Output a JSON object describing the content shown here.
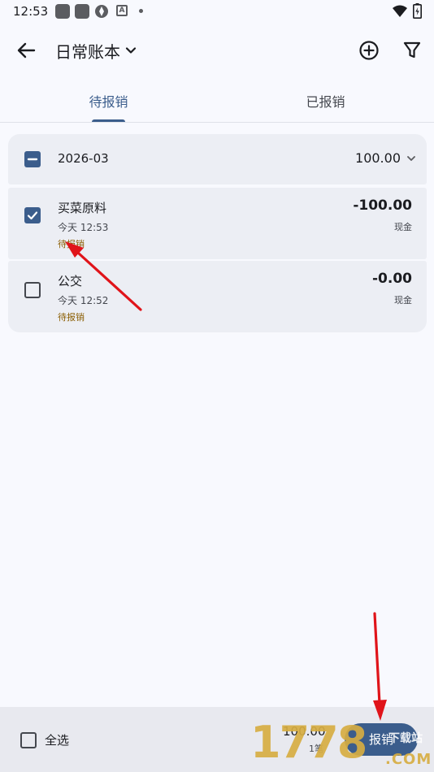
{
  "status_bar": {
    "time": "12:53",
    "notification_icon": "A"
  },
  "app_bar": {
    "title": "日常账本"
  },
  "tabs": [
    {
      "label": "待报销",
      "selected": true
    },
    {
      "label": "已报销",
      "selected": false
    }
  ],
  "group": {
    "month": "2026-03",
    "total": "100.00",
    "checkbox_state": "indeterminate"
  },
  "items": [
    {
      "title": "买菜原料",
      "time": "今天 12:53",
      "status": "待报销",
      "amount": "-100.00",
      "account": "现金",
      "checked": true
    },
    {
      "title": "公交",
      "time": "今天 12:52",
      "status": "待报销",
      "amount": "-0.00",
      "account": "现金",
      "checked": false
    }
  ],
  "bottom_bar": {
    "select_all_label": "全选",
    "total": "100.00",
    "count": "1笔",
    "action_label": "报销"
  },
  "watermark": {
    "number": "1778",
    "site": "下载站",
    "domain": ".COM"
  },
  "colors": {
    "primary": "#3b5d8c",
    "background": "#f8f9fe",
    "surface": "#eceef4",
    "status_text": "#8a5d00",
    "arrow": "#e0141a"
  },
  "icons": {
    "back": "arrow-left-icon",
    "dropdown": "chevron-down-icon",
    "add": "plus-circle-icon",
    "filter": "filter-icon",
    "group_expand": "chevron-down-icon",
    "checkbox_checked": "check-icon",
    "checkbox_partial": "minus-icon"
  }
}
